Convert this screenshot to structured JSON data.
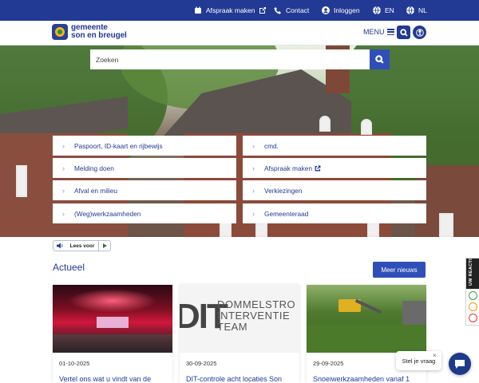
{
  "topbar": {
    "items": [
      {
        "label": "Afspraak maken",
        "icon": "calendar-icon"
      },
      {
        "label": "Contact",
        "icon": "phone-icon"
      },
      {
        "label": "Inloggen",
        "icon": "user-icon"
      },
      {
        "label": "EN",
        "icon": "globe-icon"
      },
      {
        "label": "NL",
        "icon": "globe-icon"
      }
    ]
  },
  "header": {
    "logo_line1": "gemeente",
    "logo_line2": "son en breugel",
    "menu_label": "MENU"
  },
  "search": {
    "placeholder": "Zoeken"
  },
  "quick_links": {
    "left": [
      "Paspoort, ID-kaart en rijbewijs",
      "Melding doen",
      "Afval en milieu",
      "(Weg)werkzaamheden"
    ],
    "right": [
      "cmd.",
      "Afspraak maken",
      "Verkiezingen",
      "Gemeenteraad"
    ]
  },
  "lees_voor": {
    "label": "Lees voor"
  },
  "news": {
    "heading": "Actueel",
    "more_label": "Meer nieuws",
    "items": [
      {
        "date": "01-10-2025",
        "title": "Vertel ons wat u vindt van de"
      },
      {
        "date": "30-09-2025",
        "title": "DIT-controle acht locaties Son",
        "image_text": "DOMMELSTRO INTERVENTIE TEAM",
        "image_logo": "DIT"
      },
      {
        "date": "29-09-2025",
        "title": "Snoeiwerkzaamheden vanaf 1"
      }
    ]
  },
  "feedback_tab": {
    "label": "UW REACTIE"
  },
  "chat": {
    "bubble_label": "Stel je vraag",
    "close_label": "×"
  },
  "colors": {
    "primary": "#223a94",
    "button": "#2f4fb8"
  }
}
